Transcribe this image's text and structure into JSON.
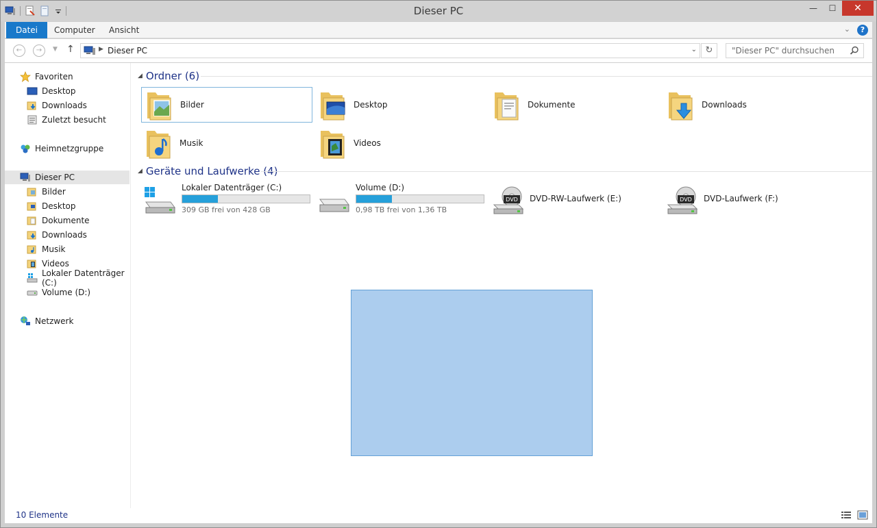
{
  "window": {
    "title": "Dieser PC",
    "controls": {
      "minimize": "—",
      "maximize": "☐",
      "close": "✕"
    }
  },
  "ribbon": {
    "tabs": [
      "Datei",
      "Computer",
      "Ansicht"
    ],
    "accent": "#1979ca"
  },
  "navigation": {
    "back": "←",
    "forward": "→",
    "up": "↑",
    "address_path": "Dieser PC",
    "search_placeholder": "\"Dieser PC\" durchsuchen"
  },
  "sidebar": {
    "favorites_label": "Favoriten",
    "favorites": [
      "Desktop",
      "Downloads",
      "Zuletzt besucht"
    ],
    "homegroup_label": "Heimnetzgruppe",
    "thispc_label": "Dieser PC",
    "thispc_items": [
      "Bilder",
      "Desktop",
      "Dokumente",
      "Downloads",
      "Musik",
      "Videos",
      "Lokaler Datenträger (C:)",
      "Volume (D:)"
    ],
    "network_label": "Netzwerk"
  },
  "folders_group": {
    "title": "Ordner (6)",
    "items": [
      "Bilder",
      "Desktop",
      "Dokumente",
      "Downloads",
      "Musik",
      "Videos"
    ]
  },
  "devices_group": {
    "title": "Geräte und Laufwerke (4)",
    "drives": [
      {
        "name": "Lokaler Datenträger (C:)",
        "free_text": "309 GB frei von 428 GB",
        "used_fraction": 0.28
      },
      {
        "name": "Volume (D:)",
        "free_text": "0,98 TB frei von 1,36 TB",
        "used_fraction": 0.28
      },
      {
        "name": "DVD-RW-Laufwerk (E:)"
      },
      {
        "name": "DVD-Laufwerk (F:)"
      }
    ],
    "dvd_label": "DVD"
  },
  "statusbar": {
    "count": "10 Elemente"
  }
}
